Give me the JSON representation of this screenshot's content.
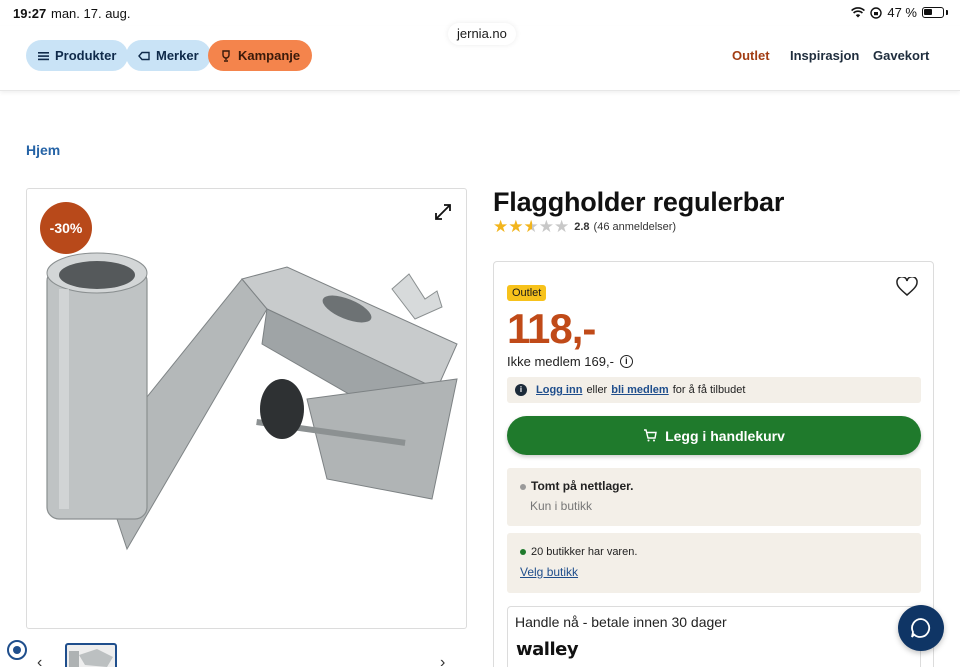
{
  "statusbar": {
    "time": "19:27",
    "date": "man. 17. aug.",
    "battery": "47 %",
    "url": "jernia.no"
  },
  "header": {
    "pills": [
      {
        "label": "Produkter",
        "icon": "menu-icon"
      },
      {
        "label": "Merker",
        "icon": "tag-icon"
      },
      {
        "label": "Kampanje",
        "icon": "trophy-icon"
      }
    ],
    "nav": [
      "Outlet",
      "Inspirasjon",
      "Gavekort"
    ]
  },
  "breadcrumb": "Hjem",
  "gallery": {
    "discount": "-30%"
  },
  "product": {
    "title": "Flaggholder regulerbar",
    "rating_value": 2.8,
    "rating_text": "2.8",
    "reviews": "(46 anmeldelser)",
    "badge": "Outlet",
    "price": "118,-",
    "non_member": "Ikke medlem 169,-",
    "login": {
      "link1": "Logg inn",
      "mid": "eller",
      "link2": "bli medlem",
      "tail": "for å få tilbudet"
    },
    "cart_button": "Legg i handlekurv",
    "stock_online": {
      "title": "Tomt på nettlager.",
      "sub": "Kun i butikk"
    },
    "stock_store": {
      "title": "20 butikker har varen.",
      "link": "Velg butikk"
    },
    "payment": {
      "text": "Handle nå - betale innen 30 dager",
      "logo": "walley"
    }
  },
  "colors": {
    "accent": "#c04a18",
    "cart": "#1f7a2c",
    "link": "#1f4e8c",
    "badge": "#f7c21b"
  }
}
